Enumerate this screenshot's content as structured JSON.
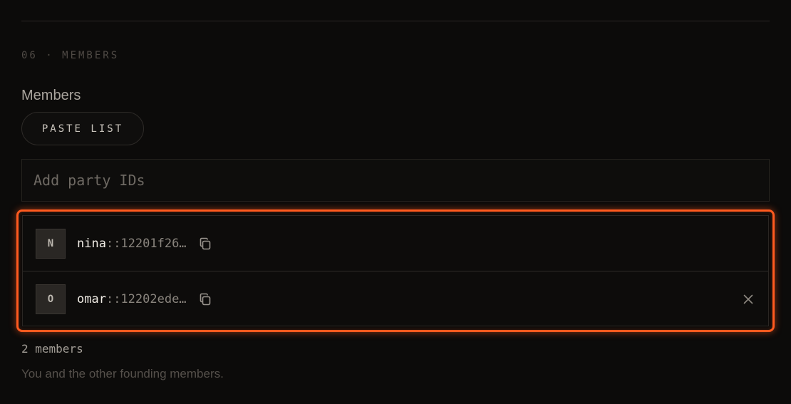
{
  "section": {
    "kicker": "06 · MEMBERS"
  },
  "members_field": {
    "label": "Members",
    "paste_button_label": "PASTE LIST",
    "input_placeholder": "Add party IDs",
    "input_value": ""
  },
  "members": [
    {
      "initial": "N",
      "name": "nina",
      "hash": "::12201f26…",
      "removable": false
    },
    {
      "initial": "O",
      "name": "omar",
      "hash": "::12202ede…",
      "removable": true
    }
  ],
  "footer": {
    "count_text": "2 members",
    "help_text": "You and the other founding members."
  },
  "colors": {
    "highlight": "#ff5a1f",
    "background": "#0c0b0a"
  },
  "icons": {
    "copy": "copy-icon",
    "remove": "close-icon"
  }
}
